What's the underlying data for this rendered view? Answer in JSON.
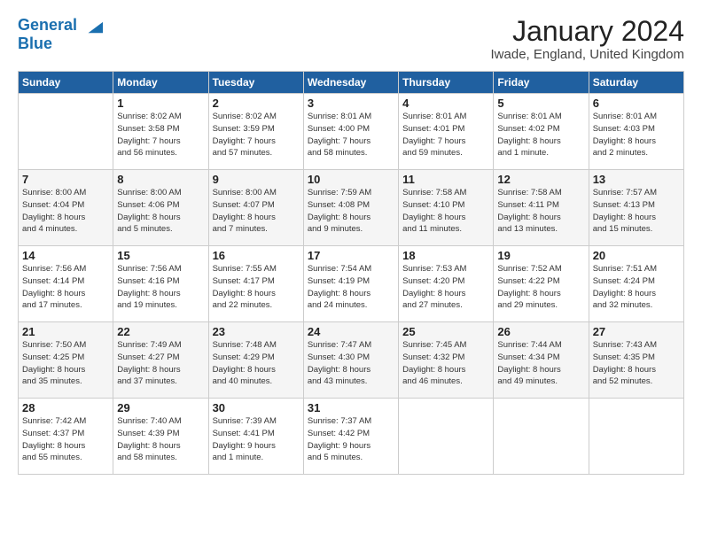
{
  "header": {
    "logo_line1": "General",
    "logo_line2": "Blue",
    "month_title": "January 2024",
    "location": "Iwade, England, United Kingdom"
  },
  "weekdays": [
    "Sunday",
    "Monday",
    "Tuesday",
    "Wednesday",
    "Thursday",
    "Friday",
    "Saturday"
  ],
  "weeks": [
    [
      {
        "day": "",
        "info": ""
      },
      {
        "day": "1",
        "info": "Sunrise: 8:02 AM\nSunset: 3:58 PM\nDaylight: 7 hours\nand 56 minutes."
      },
      {
        "day": "2",
        "info": "Sunrise: 8:02 AM\nSunset: 3:59 PM\nDaylight: 7 hours\nand 57 minutes."
      },
      {
        "day": "3",
        "info": "Sunrise: 8:01 AM\nSunset: 4:00 PM\nDaylight: 7 hours\nand 58 minutes."
      },
      {
        "day": "4",
        "info": "Sunrise: 8:01 AM\nSunset: 4:01 PM\nDaylight: 7 hours\nand 59 minutes."
      },
      {
        "day": "5",
        "info": "Sunrise: 8:01 AM\nSunset: 4:02 PM\nDaylight: 8 hours\nand 1 minute."
      },
      {
        "day": "6",
        "info": "Sunrise: 8:01 AM\nSunset: 4:03 PM\nDaylight: 8 hours\nand 2 minutes."
      }
    ],
    [
      {
        "day": "7",
        "info": "Sunrise: 8:00 AM\nSunset: 4:04 PM\nDaylight: 8 hours\nand 4 minutes."
      },
      {
        "day": "8",
        "info": "Sunrise: 8:00 AM\nSunset: 4:06 PM\nDaylight: 8 hours\nand 5 minutes."
      },
      {
        "day": "9",
        "info": "Sunrise: 8:00 AM\nSunset: 4:07 PM\nDaylight: 8 hours\nand 7 minutes."
      },
      {
        "day": "10",
        "info": "Sunrise: 7:59 AM\nSunset: 4:08 PM\nDaylight: 8 hours\nand 9 minutes."
      },
      {
        "day": "11",
        "info": "Sunrise: 7:58 AM\nSunset: 4:10 PM\nDaylight: 8 hours\nand 11 minutes."
      },
      {
        "day": "12",
        "info": "Sunrise: 7:58 AM\nSunset: 4:11 PM\nDaylight: 8 hours\nand 13 minutes."
      },
      {
        "day": "13",
        "info": "Sunrise: 7:57 AM\nSunset: 4:13 PM\nDaylight: 8 hours\nand 15 minutes."
      }
    ],
    [
      {
        "day": "14",
        "info": "Sunrise: 7:56 AM\nSunset: 4:14 PM\nDaylight: 8 hours\nand 17 minutes."
      },
      {
        "day": "15",
        "info": "Sunrise: 7:56 AM\nSunset: 4:16 PM\nDaylight: 8 hours\nand 19 minutes."
      },
      {
        "day": "16",
        "info": "Sunrise: 7:55 AM\nSunset: 4:17 PM\nDaylight: 8 hours\nand 22 minutes."
      },
      {
        "day": "17",
        "info": "Sunrise: 7:54 AM\nSunset: 4:19 PM\nDaylight: 8 hours\nand 24 minutes."
      },
      {
        "day": "18",
        "info": "Sunrise: 7:53 AM\nSunset: 4:20 PM\nDaylight: 8 hours\nand 27 minutes."
      },
      {
        "day": "19",
        "info": "Sunrise: 7:52 AM\nSunset: 4:22 PM\nDaylight: 8 hours\nand 29 minutes."
      },
      {
        "day": "20",
        "info": "Sunrise: 7:51 AM\nSunset: 4:24 PM\nDaylight: 8 hours\nand 32 minutes."
      }
    ],
    [
      {
        "day": "21",
        "info": "Sunrise: 7:50 AM\nSunset: 4:25 PM\nDaylight: 8 hours\nand 35 minutes."
      },
      {
        "day": "22",
        "info": "Sunrise: 7:49 AM\nSunset: 4:27 PM\nDaylight: 8 hours\nand 37 minutes."
      },
      {
        "day": "23",
        "info": "Sunrise: 7:48 AM\nSunset: 4:29 PM\nDaylight: 8 hours\nand 40 minutes."
      },
      {
        "day": "24",
        "info": "Sunrise: 7:47 AM\nSunset: 4:30 PM\nDaylight: 8 hours\nand 43 minutes."
      },
      {
        "day": "25",
        "info": "Sunrise: 7:45 AM\nSunset: 4:32 PM\nDaylight: 8 hours\nand 46 minutes."
      },
      {
        "day": "26",
        "info": "Sunrise: 7:44 AM\nSunset: 4:34 PM\nDaylight: 8 hours\nand 49 minutes."
      },
      {
        "day": "27",
        "info": "Sunrise: 7:43 AM\nSunset: 4:35 PM\nDaylight: 8 hours\nand 52 minutes."
      }
    ],
    [
      {
        "day": "28",
        "info": "Sunrise: 7:42 AM\nSunset: 4:37 PM\nDaylight: 8 hours\nand 55 minutes."
      },
      {
        "day": "29",
        "info": "Sunrise: 7:40 AM\nSunset: 4:39 PM\nDaylight: 8 hours\nand 58 minutes."
      },
      {
        "day": "30",
        "info": "Sunrise: 7:39 AM\nSunset: 4:41 PM\nDaylight: 9 hours\nand 1 minute."
      },
      {
        "day": "31",
        "info": "Sunrise: 7:37 AM\nSunset: 4:42 PM\nDaylight: 9 hours\nand 5 minutes."
      },
      {
        "day": "",
        "info": ""
      },
      {
        "day": "",
        "info": ""
      },
      {
        "day": "",
        "info": ""
      }
    ]
  ]
}
